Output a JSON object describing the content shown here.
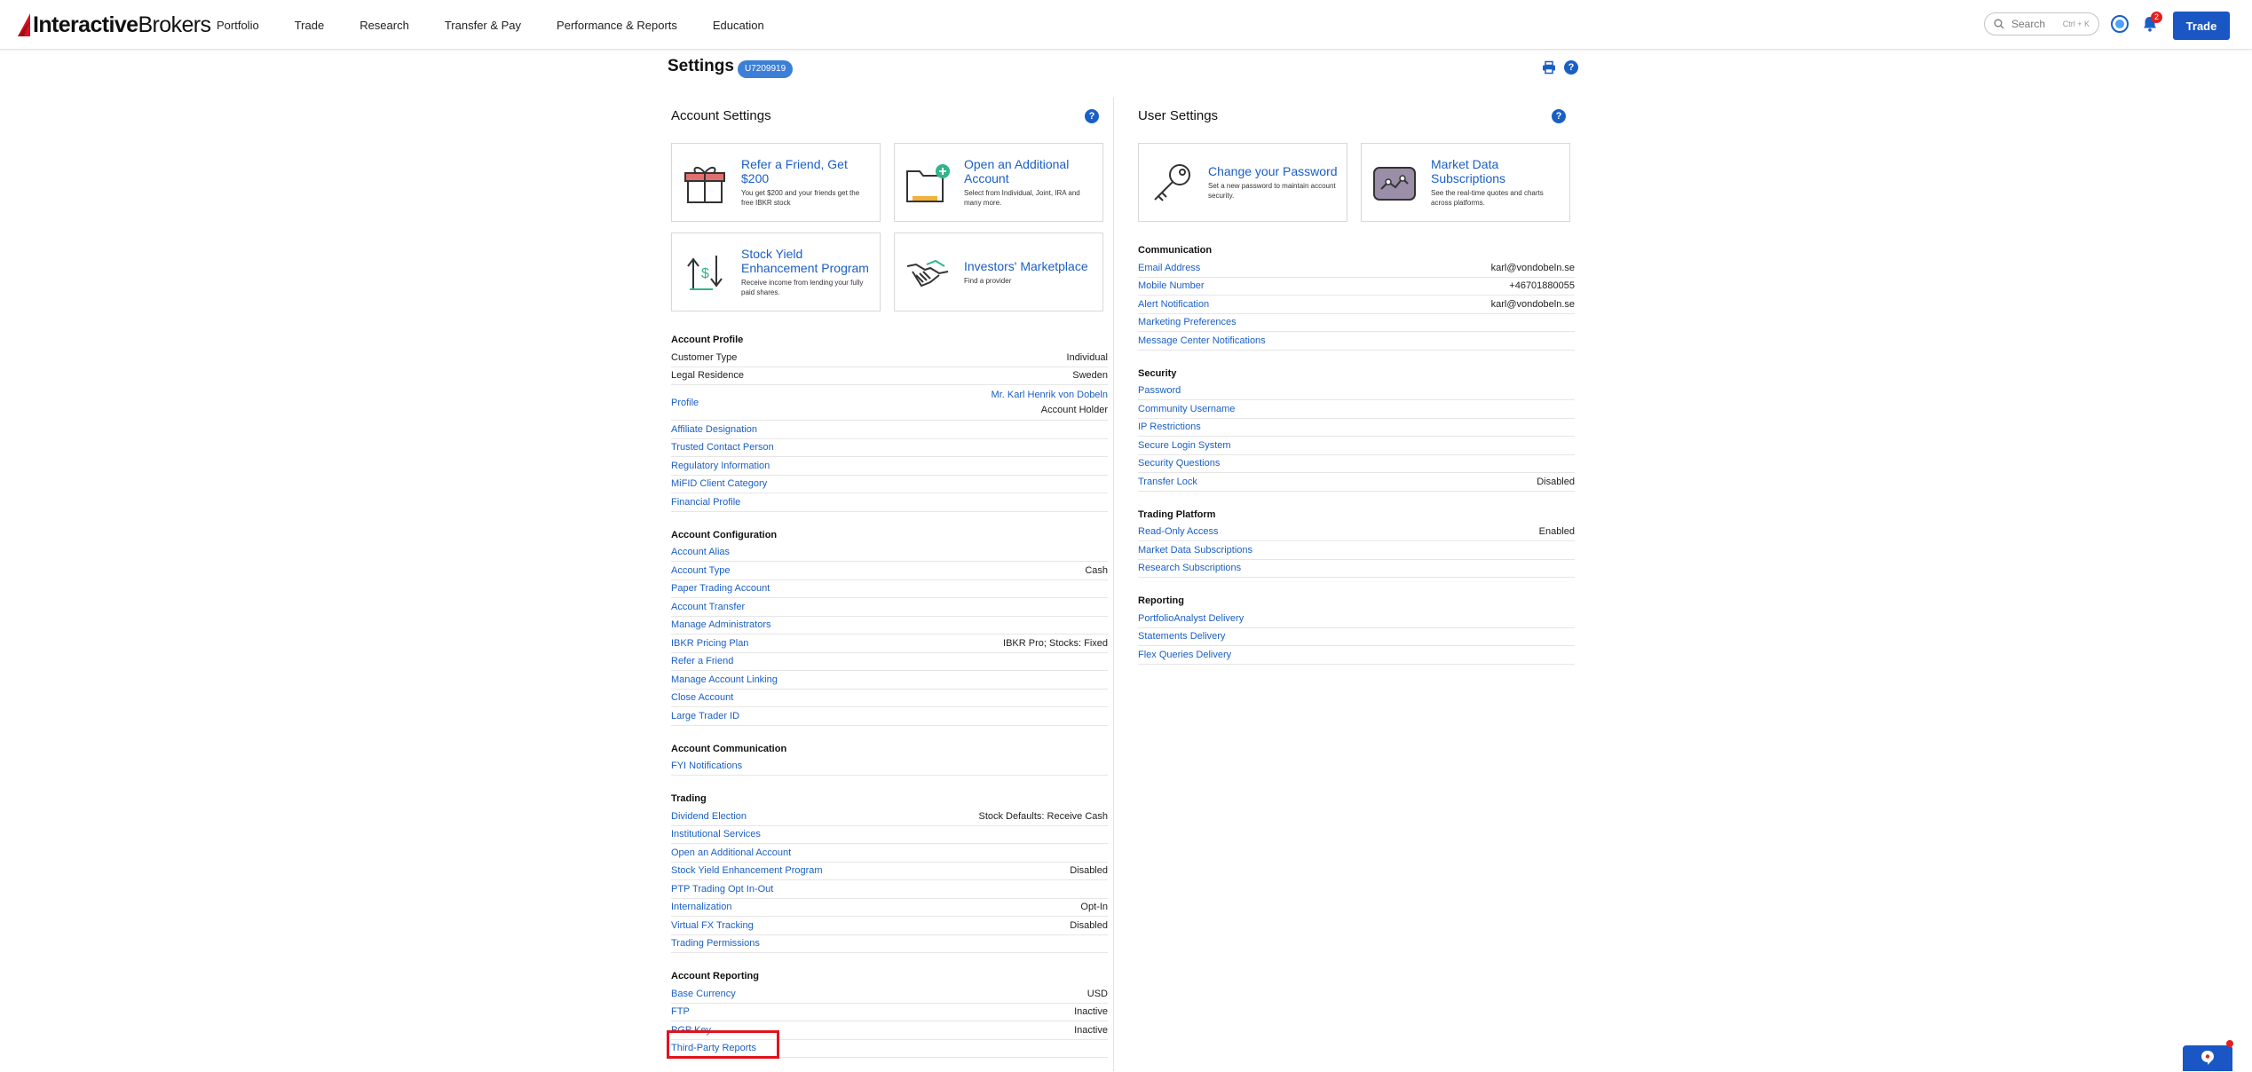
{
  "brand": {
    "bold": "Interactive",
    "normal": "Brokers"
  },
  "nav": [
    "Portfolio",
    "Trade",
    "Research",
    "Transfer & Pay",
    "Performance & Reports",
    "Education"
  ],
  "search": {
    "placeholder": "Search",
    "shortcut": "Ctrl + K"
  },
  "notifications": {
    "count": "2"
  },
  "trade_button": "Trade",
  "page": {
    "title": "Settings",
    "account_id": "U7209919"
  },
  "colors": {
    "accent": "#1a5fc4",
    "primary_button": "#1a56c4",
    "highlight": "#e0141e",
    "badge": "#e02020"
  },
  "account_settings": {
    "heading": "Account Settings",
    "cards": [
      {
        "title": "Refer a Friend, Get $200",
        "desc": "You get $200 and your friends get the free IBKR stock",
        "icon": "gift-icon"
      },
      {
        "title": "Open an Additional Account",
        "desc": "Select from Individual, Joint, IRA and many more.",
        "icon": "folder-add-icon"
      },
      {
        "title": "Stock Yield Enhancement Program",
        "desc": "Receive income from lending your fully paid shares.",
        "icon": "stock-yield-icon"
      },
      {
        "title": "Investors' Marketplace",
        "desc": "Find a provider",
        "icon": "handshake-icon"
      }
    ],
    "sections": [
      {
        "title": "Account Profile",
        "rows": [
          {
            "label": "Customer Type",
            "value": "Individual",
            "static": true
          },
          {
            "label": "Legal Residence",
            "value": "Sweden",
            "static": true
          },
          {
            "label": "Profile",
            "value_link": "Mr. Karl Henrik von Dobeln",
            "value": "Account Holder"
          },
          {
            "label": "Affiliate Designation"
          },
          {
            "label": "Trusted Contact Person"
          },
          {
            "label": "Regulatory Information"
          },
          {
            "label": "MiFID Client Category"
          },
          {
            "label": "Financial Profile"
          }
        ]
      },
      {
        "title": "Account Configuration",
        "rows": [
          {
            "label": "Account Alias"
          },
          {
            "label": "Account Type",
            "value": "Cash"
          },
          {
            "label": "Paper Trading Account"
          },
          {
            "label": "Account Transfer"
          },
          {
            "label": "Manage Administrators"
          },
          {
            "label": "IBKR Pricing Plan",
            "value": "IBKR Pro; Stocks: Fixed"
          },
          {
            "label": "Refer a Friend"
          },
          {
            "label": "Manage Account Linking"
          },
          {
            "label": "Close Account"
          },
          {
            "label": "Large Trader ID"
          }
        ]
      },
      {
        "title": "Account Communication",
        "rows": [
          {
            "label": "FYI Notifications"
          }
        ]
      },
      {
        "title": "Trading",
        "rows": [
          {
            "label": "Dividend Election",
            "value": "Stock Defaults: Receive Cash"
          },
          {
            "label": "Institutional Services"
          },
          {
            "label": "Open an Additional Account"
          },
          {
            "label": "Stock Yield Enhancement Program",
            "value": "Disabled"
          },
          {
            "label": "PTP Trading Opt In-Out"
          },
          {
            "label": "Internalization",
            "value": "Opt-In"
          },
          {
            "label": "Virtual FX Tracking",
            "value": "Disabled"
          },
          {
            "label": "Trading Permissions"
          }
        ]
      },
      {
        "title": "Account Reporting",
        "rows": [
          {
            "label": "Base Currency",
            "value": "USD"
          },
          {
            "label": "FTP",
            "value": "Inactive"
          },
          {
            "label": "PGP Key",
            "value": "Inactive"
          },
          {
            "label": "Third-Party Reports"
          }
        ]
      }
    ]
  },
  "user_settings": {
    "heading": "User Settings",
    "cards": [
      {
        "title": "Change your Password",
        "desc": "Set a new password to maintain account security.",
        "icon": "key-icon"
      },
      {
        "title": "Market Data Subscriptions",
        "desc": "See the real-time quotes and charts across platforms.",
        "icon": "market-data-icon"
      }
    ],
    "sections": [
      {
        "title": "Communication",
        "rows": [
          {
            "label": "Email Address",
            "value": "karl@vondobeln.se"
          },
          {
            "label": "Mobile Number",
            "value": "+46701880055"
          },
          {
            "label": "Alert Notification",
            "value": "karl@vondobeln.se"
          },
          {
            "label": "Marketing Preferences"
          },
          {
            "label": "Message Center Notifications"
          }
        ]
      },
      {
        "title": "Security",
        "rows": [
          {
            "label": "Password"
          },
          {
            "label": "Community Username"
          },
          {
            "label": "IP Restrictions"
          },
          {
            "label": "Secure Login System"
          },
          {
            "label": "Security Questions"
          },
          {
            "label": "Transfer Lock",
            "value": "Disabled"
          }
        ]
      },
      {
        "title": "Trading Platform",
        "rows": [
          {
            "label": "Read-Only Access",
            "value": "Enabled"
          },
          {
            "label": "Market Data Subscriptions"
          },
          {
            "label": "Research Subscriptions"
          }
        ]
      },
      {
        "title": "Reporting",
        "rows": [
          {
            "label": "PortfolioAnalyst Delivery"
          },
          {
            "label": "Statements Delivery"
          },
          {
            "label": "Flex Queries Delivery"
          }
        ]
      }
    ]
  }
}
